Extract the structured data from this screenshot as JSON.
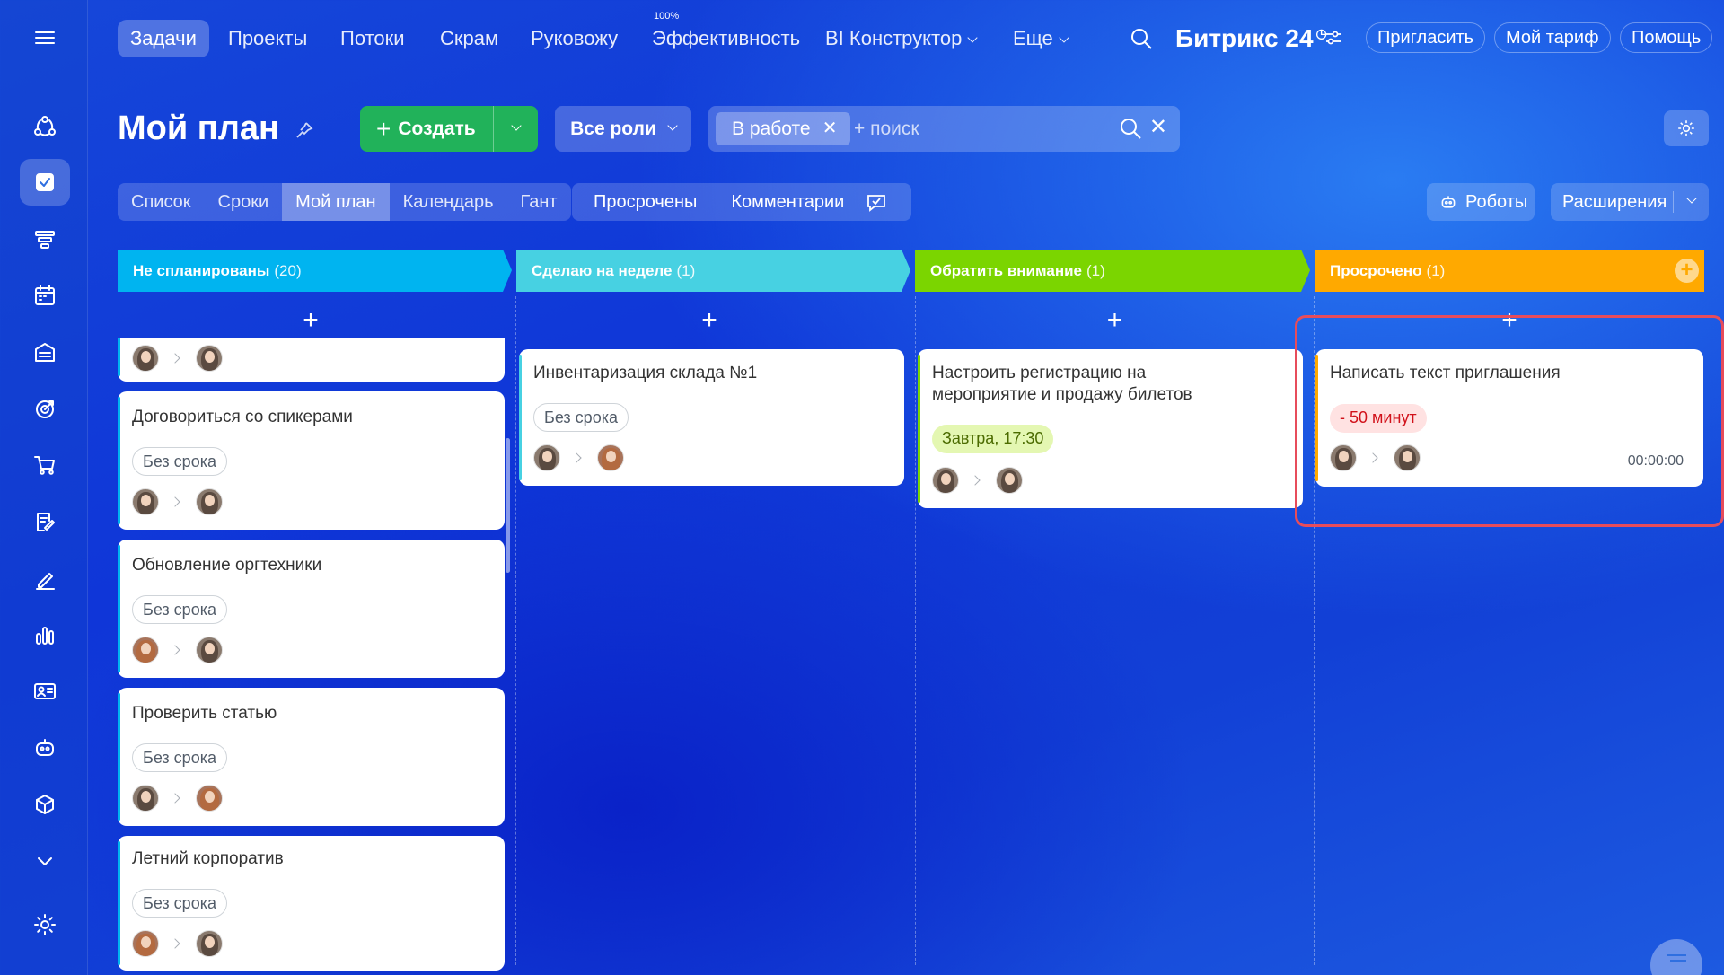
{
  "topnav": {
    "items": [
      "Задачи",
      "Проекты",
      "Потоки",
      "Скрам",
      "Руковожу",
      "Эффективность",
      "BI Конструктор",
      "Еще"
    ],
    "efficiency_badge": "100%",
    "brand_name": "Битрикс",
    "brand_number": "24",
    "invite": "Пригласить",
    "tariff": "Мой тариф",
    "help": "Помощь"
  },
  "toolbar": {
    "title": "Мой план",
    "create": "Создать",
    "roles": "Все роли",
    "filter_chip": "В работе",
    "search_placeholder": "+ поиск"
  },
  "views": {
    "tabs": [
      "Список",
      "Сроки",
      "Мой план",
      "Календарь",
      "Гант"
    ],
    "active": "Мой план",
    "overdue": "Просрочены",
    "comments": "Комментарии",
    "robots": "Роботы",
    "extensions": "Расширения"
  },
  "columns": [
    {
      "title": "Не спланированы",
      "count": "(20)",
      "color": "#00b4f0"
    },
    {
      "title": "Сделаю на неделе",
      "count": "(1)",
      "color": "#47d1e2"
    },
    {
      "title": "Обратить внимание",
      "count": "(1)",
      "color": "#7bd500"
    },
    {
      "title": "Просрочено",
      "count": "(1)",
      "color": "#ffa900"
    }
  ],
  "cards": {
    "c1": {
      "title": "Договориться со спикерами",
      "tag": "Без срока"
    },
    "c2": {
      "title": "Обновление оргтехники",
      "tag": "Без срока"
    },
    "c3": {
      "title": "Проверить статью",
      "tag": "Без срока"
    },
    "c4": {
      "title": "Летний корпоратив",
      "tag": "Без срока"
    },
    "c5": {
      "title": "Инвентаризация склада №1",
      "tag": "Без срока"
    },
    "c6": {
      "title_line1": "Настроить регистрацию на",
      "title_line2": "мероприятие и продажу билетов",
      "tag": "Завтра, 17:30"
    },
    "c7": {
      "title": "Написать текст приглашения",
      "tag": "- 50 минут",
      "timer": "00:00:00"
    }
  },
  "colors": {
    "accent_green": "#21b25a",
    "overdue_red": "#d1111a",
    "highlight": "#e74c5b"
  }
}
